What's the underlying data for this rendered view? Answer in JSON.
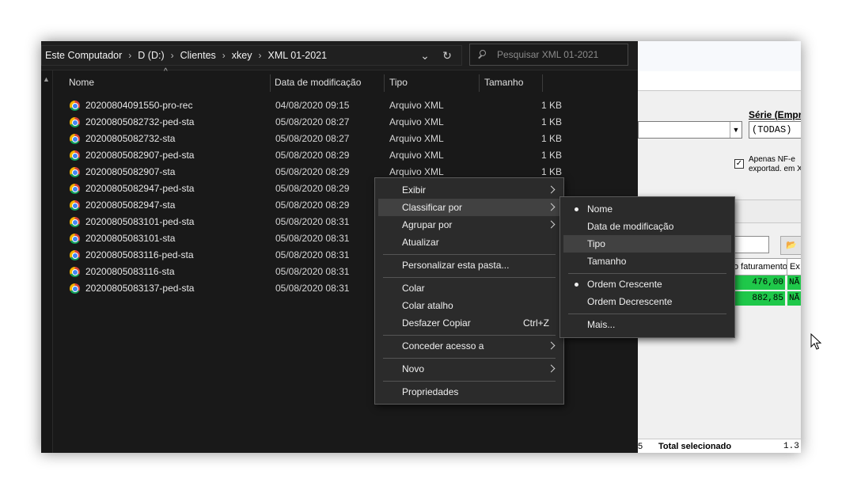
{
  "explorer": {
    "breadcrumb": [
      "Este Computador",
      "D (D:)",
      "Clientes",
      "xkey",
      "XML 01-2021"
    ],
    "search_placeholder": "Pesquisar XML 01-2021",
    "columns": {
      "name": "Nome",
      "date": "Data de modificação",
      "type": "Tipo",
      "size": "Tamanho"
    },
    "files": [
      {
        "name": "20200804091550-pro-rec",
        "date": "04/08/2020 09:15",
        "type": "Arquivo XML",
        "size": "1 KB"
      },
      {
        "name": "20200805082732-ped-sta",
        "date": "05/08/2020 08:27",
        "type": "Arquivo XML",
        "size": "1 KB"
      },
      {
        "name": "20200805082732-sta",
        "date": "05/08/2020 08:27",
        "type": "Arquivo XML",
        "size": "1 KB"
      },
      {
        "name": "20200805082907-ped-sta",
        "date": "05/08/2020 08:29",
        "type": "Arquivo XML",
        "size": "1 KB"
      },
      {
        "name": "20200805082907-sta",
        "date": "05/08/2020 08:29",
        "type": "Arquivo XML",
        "size": "1 KB"
      },
      {
        "name": "20200805082947-ped-sta",
        "date": "05/08/2020 08:29",
        "type": "",
        "size": ""
      },
      {
        "name": "20200805082947-sta",
        "date": "05/08/2020 08:29",
        "type": "",
        "size": ""
      },
      {
        "name": "20200805083101-ped-sta",
        "date": "05/08/2020 08:31",
        "type": "",
        "size": ""
      },
      {
        "name": "20200805083101-sta",
        "date": "05/08/2020 08:31",
        "type": "",
        "size": ""
      },
      {
        "name": "20200805083116-ped-sta",
        "date": "05/08/2020 08:31",
        "type": "",
        "size": ""
      },
      {
        "name": "20200805083116-sta",
        "date": "05/08/2020 08:31",
        "type": "",
        "size": ""
      },
      {
        "name": "20200805083137-ped-sta",
        "date": "05/08/2020 08:31",
        "type": "",
        "size": ""
      }
    ]
  },
  "context_menu": {
    "exibir": "Exibir",
    "classificar": "Classificar por",
    "agrupar": "Agrupar por",
    "atualizar": "Atualizar",
    "personalizar": "Personalizar esta pasta...",
    "colar": "Colar",
    "colar_atalho": "Colar atalho",
    "desfazer": "Desfazer Copiar",
    "desfazer_shortcut": "Ctrl+Z",
    "conceder": "Conceder acesso a",
    "novo": "Novo",
    "propriedades": "Propriedades"
  },
  "sort_menu": {
    "nome": "Nome",
    "data": "Data de modificação",
    "tipo": "Tipo",
    "tamanho": "Tamanho",
    "crescente": "Ordem Crescente",
    "decrescente": "Ordem Decrescente",
    "mais": "Mais..."
  },
  "background_app": {
    "serie_label": "Série (Empr.",
    "serie_value": "(TODAS)",
    "checkbox_text_1": "Apenas NF-e",
    "checkbox_text_2": "exportad. em X",
    "col_faturamento": "o faturamento",
    "col_ex": "Ex",
    "row1_value": "476,00",
    "row1_flag": "NÃ",
    "row2_value": "882,85",
    "row2_flag": "NÃ",
    "total_label": "Total selecionado",
    "total_value": "1.3",
    "bottom_prefix": "5"
  },
  "colors": {
    "explorer_bg": "#191919",
    "menu_bg": "#2b2b2b",
    "grid_green": "#1fc84a"
  }
}
